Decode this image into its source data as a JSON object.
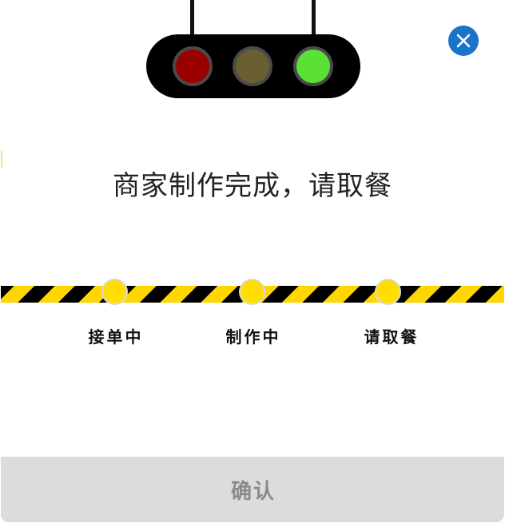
{
  "dialog": {
    "title": "商家制作完成，请取餐",
    "close_icon": "close-icon"
  },
  "traffic_light": {
    "lamps": [
      {
        "name": "red",
        "color": "#9b0000",
        "state": "off"
      },
      {
        "name": "yellow",
        "color": "#6b5f32",
        "state": "off"
      },
      {
        "name": "green",
        "color": "#5be036",
        "state": "on"
      }
    ]
  },
  "progress": {
    "current_step": 3,
    "steps": [
      {
        "label": "接单中"
      },
      {
        "label": "制作中"
      },
      {
        "label": "请取餐"
      }
    ]
  },
  "colors": {
    "close_button": "#1a73c8",
    "stripe_yellow": "#ffd600",
    "stripe_black": "#000000",
    "confirm_bg": "#dcdcdc",
    "confirm_text": "#8a8a8a"
  },
  "footer": {
    "confirm_label": "确认"
  }
}
